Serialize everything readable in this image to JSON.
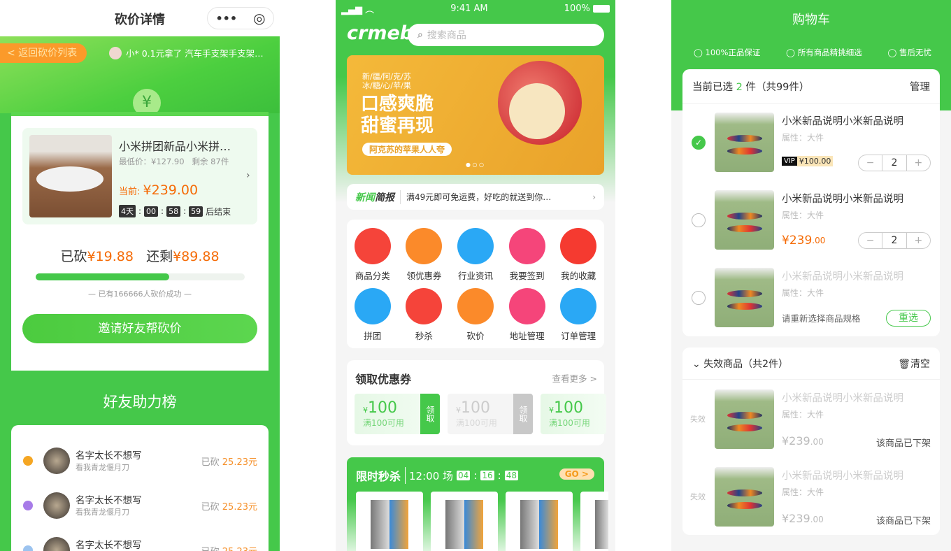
{
  "bargain": {
    "title": "砍价详情",
    "capsule_more": "•••",
    "capsule_close": "◎",
    "back_label": "< 返回砍价列表",
    "ticker": "小* 0.1元拿了 汽车手支架手支架…",
    "product": {
      "name": "小米拼团新品小米拼…",
      "min_price": "最低价：¥127.90",
      "stock": "剩余 87件",
      "current_label": "当前:",
      "current_price": "¥239.00",
      "countdown": [
        "4天",
        "00",
        "58",
        "59"
      ],
      "countdown_suffix": "后结束"
    },
    "cut_label": "已砍",
    "cut_value": "¥19.88",
    "remain_label": "还剩",
    "remain_value": "¥89.88",
    "progress_percent": 64,
    "success_note": "— 已有166666人砍价成功 —",
    "invite_button": "邀请好友帮砍价",
    "leaderboard_title": "好友助力榜",
    "helpers": [
      {
        "name": "名字太长不想写",
        "motto": "看我青龙偃月刀",
        "cut_label": "已砍",
        "amount": "25.23元",
        "medal": "#f5a623"
      },
      {
        "name": "名字太长不想写",
        "motto": "看我青龙偃月刀",
        "cut_label": "已砍",
        "amount": "25.23元",
        "medal": "#a77be8"
      },
      {
        "name": "名字太长不想写",
        "motto": "看我青龙偃月刀",
        "cut_label": "已砍",
        "amount": "25.23元",
        "medal": "#9cc3ef"
      }
    ]
  },
  "home": {
    "status": {
      "time": "9:41 AM",
      "battery": "100%"
    },
    "logo": "crmeb",
    "search_placeholder": "搜索商品",
    "banner": {
      "small1": "新/疆/阿/克/苏",
      "small2": "冰/糖/心/苹/果",
      "line1": "口感爽脆",
      "line2": "甜蜜再现",
      "tag": "阿克苏的苹果人人夸"
    },
    "news": {
      "label_a": "新闻",
      "label_b": "简报",
      "text": "满49元即可免运费，好吃的就送到你…"
    },
    "menu": [
      {
        "label": "商品分类",
        "color": "#f5443a"
      },
      {
        "label": "领优惠券",
        "color": "#fb8a2a"
      },
      {
        "label": "行业资讯",
        "color": "#2aa8f5"
      },
      {
        "label": "我要签到",
        "color": "#f5457a"
      },
      {
        "label": "我的收藏",
        "color": "#f53a30"
      },
      {
        "label": "拼团",
        "color": "#2aa8f5"
      },
      {
        "label": "秒杀",
        "color": "#f5443a"
      },
      {
        "label": "砍价",
        "color": "#fb8a2a"
      },
      {
        "label": "地址管理",
        "color": "#f5457a"
      },
      {
        "label": "订单管理",
        "color": "#2aa8f5"
      }
    ],
    "coupons": {
      "title": "领取优惠券",
      "more": "查看更多 >",
      "items": [
        {
          "amount": "100",
          "cond": "满100可用",
          "action": "领取",
          "active": true
        },
        {
          "amount": "100",
          "cond": "满100可用",
          "action": "领取",
          "active": false
        },
        {
          "amount": "100",
          "cond": "满100可用",
          "action": "",
          "active": true
        }
      ]
    },
    "flash": {
      "title": "限时秒杀",
      "session": "12:00 场",
      "countdown": [
        "04",
        "16",
        "48"
      ],
      "go": "GO >"
    }
  },
  "cart": {
    "title": "购物车",
    "guarantees": [
      "100%正品保证",
      "所有商品精挑细选",
      "售后无忧"
    ],
    "summary_a": "当前已选",
    "summary_count": "2",
    "summary_b": "件（共99件）",
    "manage": "管理",
    "items": [
      {
        "name": "小米新品说明小米新品说明",
        "attr": "属性：大件",
        "vip": "VIP",
        "price": "¥100.00",
        "qty": "2",
        "checked": true
      },
      {
        "name": "小米新品说明小米新品说明",
        "attr": "属性：大件",
        "price_int": "¥239",
        "price_dec": ".00",
        "qty": "2",
        "checked": false
      },
      {
        "name": "小米新品说明小米新品说明",
        "attr": "属性：大件",
        "note": "请重新选择商品规格",
        "reselect": "重选",
        "checked": false
      }
    ],
    "invalid": {
      "title": "失效商品（共2件）",
      "clear": "清空",
      "items": [
        {
          "tag": "失效",
          "name": "小米新品说明小米新品说明",
          "attr": "属性：大件",
          "price_int": "¥239",
          "price_dec": ".00",
          "status": "该商品已下架"
        },
        {
          "tag": "失效",
          "name": "小米新品说明小米新品说明",
          "attr": "属性：大件",
          "price_int": "¥239",
          "price_dec": ".00",
          "status": "该商品已下架"
        }
      ]
    },
    "accent": "#45c84a"
  }
}
